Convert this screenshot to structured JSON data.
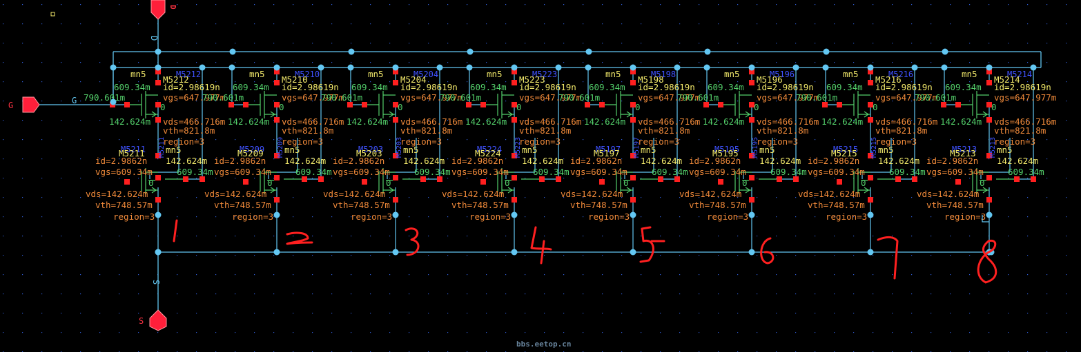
{
  "watermark": "bbs.eetop.cn",
  "pins": {
    "drain": {
      "name": "D",
      "net_label": "D"
    },
    "gate": {
      "name": "G",
      "net_label": "G"
    },
    "source": {
      "name": "S",
      "net_label": "S"
    }
  },
  "colors": {
    "background": "#000000",
    "wire": "#63c7f2",
    "device": "#54d06b",
    "param_orange": "#f08a3a",
    "param_yellow": "#f2e96b",
    "instance_blue": "#3f52ff",
    "terminal_red": "#ff1f1f",
    "pin_red": "#ff1f3a",
    "handwriting": "#ff2020"
  },
  "top_devices": {
    "model": "mn5",
    "id": "id=2.98619n",
    "vgs": "vgs=647.977m",
    "vds": "vds=466.716m",
    "vth": "vth=821.8m",
    "region": "region=3",
    "left_gate_voltage": "609.34m",
    "left_gate_offset": "790.601m",
    "left_source_voltage": "142.624m",
    "bulk": "0",
    "instances": [
      "M5212",
      "M5210",
      "M5204",
      "M5223",
      "M5198",
      "M5196",
      "M5216",
      "M5214"
    ]
  },
  "bottom_devices": {
    "model": "mn5",
    "id": "id=2.9862n",
    "vgs": "vgs=609.34m",
    "vds": "vds=142.624m",
    "vth": "vth=748.57m",
    "region": "region=3",
    "drain_voltage": "142.624m",
    "gate_voltage": "609.34m",
    "bulk": "0",
    "instances": [
      "M5211",
      "M5209",
      "M5203",
      "M5224",
      "M5197",
      "M5195",
      "M5215",
      "M5213"
    ],
    "vertical_labels": [
      "M5211",
      "M5209",
      "M5203",
      "M5223",
      "M5197",
      "M5195",
      "M5215",
      "M5213"
    ]
  },
  "handwritten_numbers": [
    "1",
    "2",
    "3",
    "4",
    "5",
    "6",
    "7",
    "8"
  ]
}
